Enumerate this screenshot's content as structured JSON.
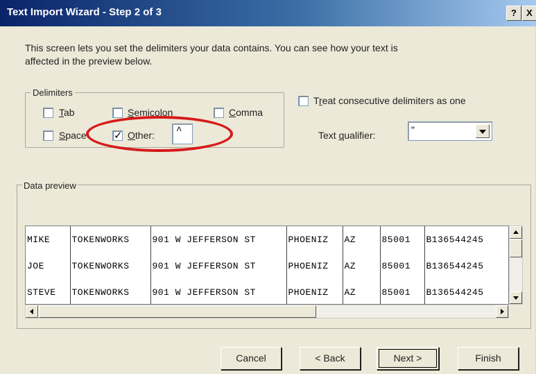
{
  "window": {
    "title": "Text Import Wizard - Step 2 of 3",
    "help_label": "?",
    "close_label": "X"
  },
  "intro_text": "This screen lets you set the delimiters your data contains.  You can see how your text is affected in the preview below.",
  "delimiters": {
    "legend": "Delimiters",
    "tab": {
      "label_pre": "",
      "label_ul": "T",
      "label_post": "ab",
      "checked": false
    },
    "semicolon": {
      "label_pre": "",
      "label_ul": "S",
      "label_post": "emicolon",
      "checked": false
    },
    "comma": {
      "label_pre": "",
      "label_ul": "C",
      "label_post": "omma",
      "checked": false
    },
    "space": {
      "label_pre": "",
      "label_ul": "S",
      "label_post": "pace",
      "checked": false
    },
    "other": {
      "label_pre": "",
      "label_ul": "O",
      "label_post": "ther:",
      "checked": true,
      "value": "^"
    }
  },
  "consecutive": {
    "label_pre": "T",
    "label_ul": "r",
    "label_post": "eat consecutive delimiters as one",
    "checked": false
  },
  "text_qualifier": {
    "label_pre": "Text ",
    "label_ul": "q",
    "label_post": "ualifier:",
    "value": "\""
  },
  "preview": {
    "legend": "Data preview",
    "rows": [
      [
        "MIKE",
        "TOKENWORKS",
        "901 W JEFFERSON ST",
        "PHOENIZ",
        "AZ",
        "85001",
        "B136544245"
      ],
      [
        "JOE",
        "TOKENWORKS",
        "901 W JEFFERSON ST",
        "PHOENIZ",
        "AZ",
        "85001",
        "B136544245"
      ],
      [
        "STEVE",
        "TOKENWORKS",
        "901 W JEFFERSON ST",
        "PHOENIZ",
        "AZ",
        "85001",
        "B136544245"
      ]
    ]
  },
  "buttons": {
    "cancel": "Cancel",
    "back": "< Back",
    "next": "Next >",
    "finish": "Finish"
  },
  "colors": {
    "title_start": "#0a246a",
    "title_end": "#a6caf0",
    "highlight_circle": "#d51a1a",
    "dialog_bg": "#ece9d8"
  }
}
